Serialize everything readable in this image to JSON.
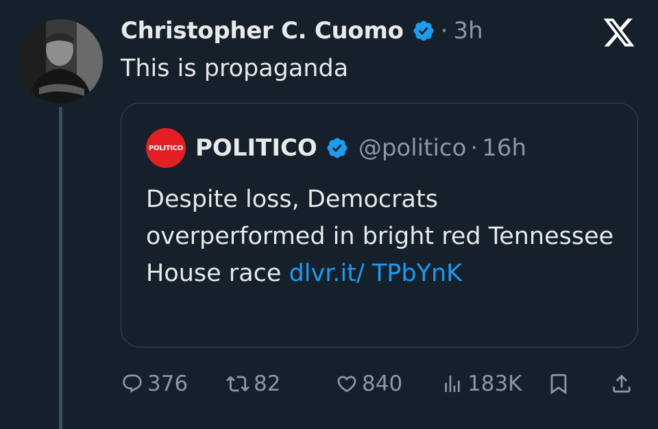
{
  "tweet": {
    "author_name": "Christopher C. Cuomo",
    "separator": "·",
    "time": "3h",
    "text": "This is propaganda"
  },
  "quoted_tweet": {
    "avatar_text": "POLITICO",
    "author_name": "POLITICO",
    "handle": "@politico",
    "separator": "·",
    "time": "16h",
    "text": "Despite loss, Democrats overperformed in bright red Tennessee House race ",
    "link_text": "dlvr.it/ TPbYnK"
  },
  "actions": {
    "replies": "376",
    "retweets": "82",
    "likes": "840",
    "views": "183K"
  },
  "colors": {
    "background": "#15202b",
    "accent": "#1d9bf0",
    "secondary_text": "#8b98a5",
    "politico_red": "#e31f26"
  },
  "icons": [
    "x-logo-icon",
    "verified-badge-icon",
    "reply-icon",
    "retweet-icon",
    "like-icon",
    "views-icon",
    "bookmark-icon",
    "share-icon"
  ]
}
